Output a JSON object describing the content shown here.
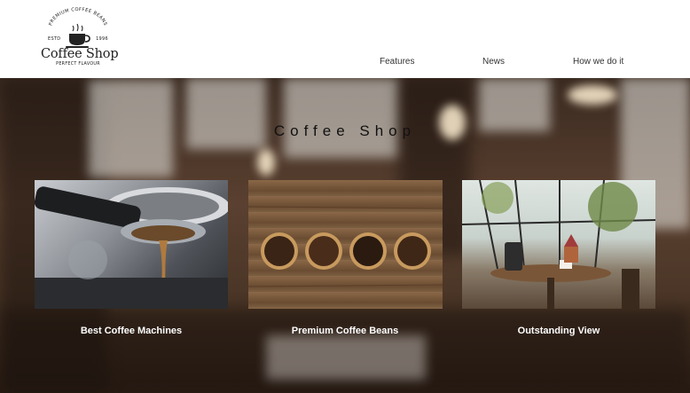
{
  "logo": {
    "arc_text": "PREMIUM COFFEE BEANS",
    "est": "ESTD",
    "year": "1996",
    "name": "Coffee Shop",
    "tagline": "PERFECT FLAVOUR"
  },
  "nav": {
    "items": [
      {
        "label": "Features"
      },
      {
        "label": "News"
      },
      {
        "label": "How we do it"
      }
    ]
  },
  "hero": {
    "title": "Coffee Shop"
  },
  "cards": [
    {
      "caption": "Best Coffee Machines",
      "image": "espresso-machine"
    },
    {
      "caption": "Premium Coffee Beans",
      "image": "coffee-bean-bowls"
    },
    {
      "caption": "Outstanding View",
      "image": "cafe-window-view"
    }
  ],
  "colors": {
    "header_bg": "#ffffff",
    "topbar": "#3b3b3b",
    "caption_text": "#ffffff",
    "title_text": "#111111"
  }
}
